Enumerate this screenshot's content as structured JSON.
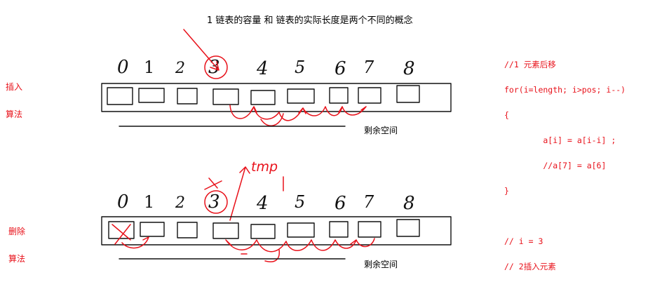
{
  "heading": "1 链表的容量 和 链表的实际长度是两个不同的概念",
  "insert_label": [
    "插入",
    "算法"
  ],
  "delete_label": [
    "删除",
    "算法"
  ],
  "remaining_space": "剩余空间",
  "index_digits": [
    "0",
    "1",
    "2",
    "3",
    "4",
    "5",
    "6",
    "7",
    "8"
  ],
  "tmp_note": "tmp",
  "code_lines": [
    "//1 元素后移",
    "for(i=length; i>pos; i--)",
    "{",
    "        a[i] = a[i-i] ;",
    "        //a[7] = a[6]",
    "}",
    "",
    "// i = 3",
    "// 2插入元素"
  ],
  "colors": {
    "annotation_red": "#e8111a",
    "ink": "#111111"
  }
}
